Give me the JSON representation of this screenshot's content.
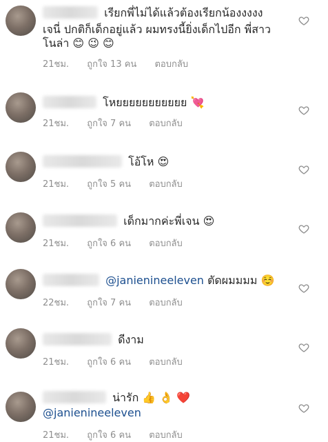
{
  "comments": [
    {
      "lines": [
        "เรียกพี่ไม่ได้แล้วต้องเรียกน้องงงงง",
        "เจนี่ ปกติก็เด็กอยู่แล้ว ผมทรงนี้ยิ่งเด็กไปอีก พี่สาว",
        "โนล่า"
      ],
      "emoji": "😊 😉 😊",
      "time": "21ชม.",
      "likes": "ถูกใจ 13 คน",
      "reply": "ตอบกลับ"
    },
    {
      "text": "โหยยยยยยยยยยย",
      "emoji": "💘",
      "time": "21ชม.",
      "likes": "ถูกใจ 7 คน",
      "reply": "ตอบกลับ"
    },
    {
      "text": "โอ้โห",
      "emoji": "😍",
      "time": "21ชม.",
      "likes": "ถูกใจ 5 คน",
      "reply": "ตอบกลับ"
    },
    {
      "text": "เด็กมากค่ะพี่เจน",
      "emoji": "😍",
      "time": "21ชม.",
      "likes": "ถูกใจ 6 คน",
      "reply": "ตอบกลับ"
    },
    {
      "mention": "@janienineeleven",
      "text": " ตัดผมมมม",
      "emoji": "☺️",
      "time": "22ชม.",
      "likes": "ถูกใจ 7 คน",
      "reply": "ตอบกลับ"
    },
    {
      "text": "ดีงาม",
      "time": "21ชม.",
      "likes": "ถูกใจ 6 คน",
      "reply": "ตอบกลับ"
    },
    {
      "text": "น่ารัก",
      "emoji": "👍 👌 ❤️",
      "mention": "@janienineeleven",
      "time": "21ชม.",
      "likes": "ถูกใจ 6 คน",
      "reply": "ตอบกลับ"
    }
  ]
}
